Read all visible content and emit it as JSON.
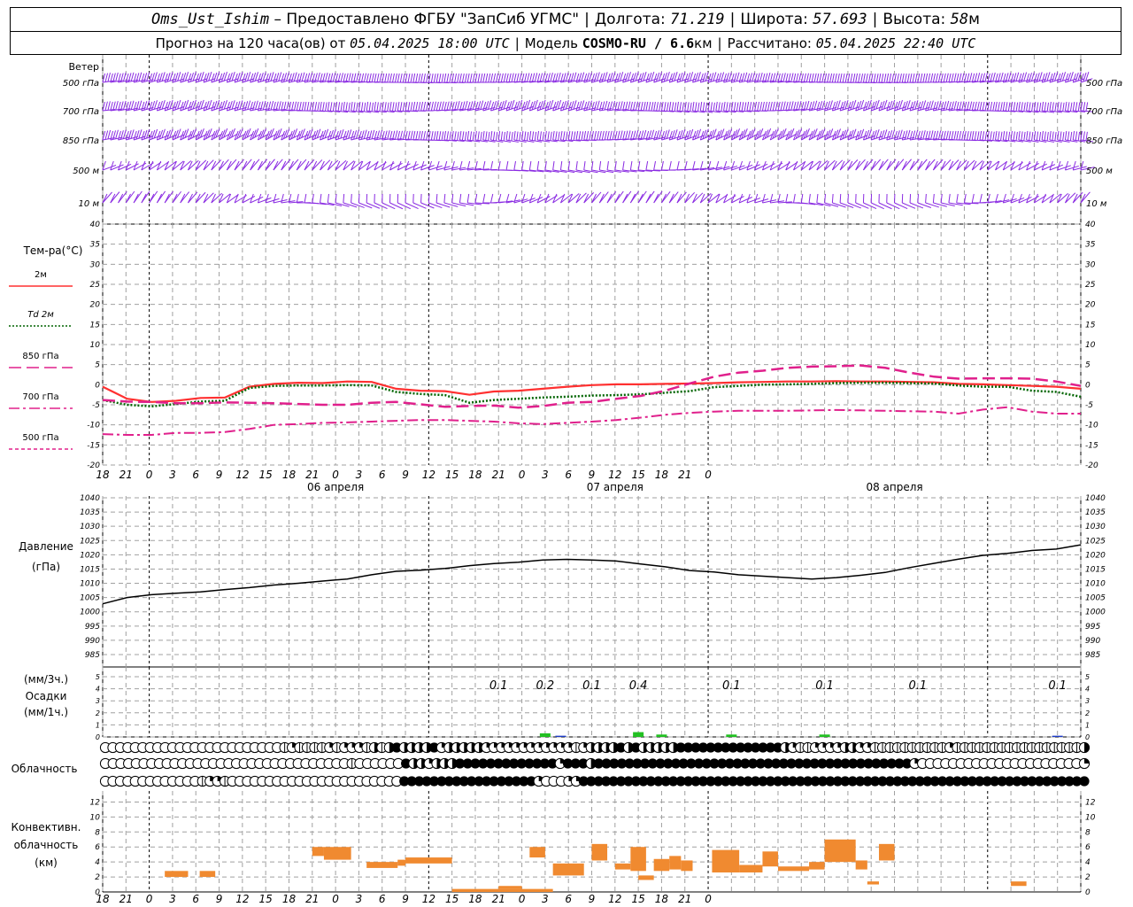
{
  "header": {
    "station": "Oms_Ust_Ishim",
    "provider": "– Предоставлено ФГБУ \"ЗапСиб УГМС\"",
    "lon_label": "Долгота:",
    "lon": "71.219",
    "lat_label": "Широта:",
    "lat": "57.693",
    "alt_label": "Высота:",
    "alt": "58",
    "alt_unit": "м",
    "forecast_label": "Прогноз на 120 часа(ов) от",
    "forecast_from": "05.04.2025 18:00 UTC",
    "model_label": "Модель",
    "model": "COSMO-RU / 6.6",
    "model_unit": "км",
    "calc_label": "Рассчитано:",
    "calc_time": "05.04.2025 22:40 UTC"
  },
  "colors": {
    "wind": "#8a2be2",
    "t2m": "#ff3030",
    "td2m": "#006400",
    "t850": "#e0208c",
    "precip_green": "#22c022",
    "precip_blue": "#1e3cc8",
    "convective": "#f08a30",
    "pressure": "#000000",
    "grid": "#a0a0a0"
  },
  "chart_data": [
    {
      "type": "barbs",
      "panel": "wind",
      "title": "Ветер",
      "levels": [
        "500 гПа",
        "700 гПа",
        "850 гПа",
        "500 м",
        "10 м"
      ]
    },
    {
      "type": "line",
      "panel": "temperature",
      "title": "Тем-ра(°С)",
      "ylim": [
        -20,
        40
      ],
      "yticks": [
        -20,
        -15,
        -10,
        -5,
        0,
        5,
        10,
        15,
        20,
        25,
        30,
        35,
        40
      ],
      "x_ticks": [
        "18",
        "21",
        "0",
        "3",
        "6",
        "9",
        "12",
        "15",
        "18",
        "21",
        "0",
        "3",
        "6",
        "9",
        "12",
        "15",
        "18",
        "21",
        "0",
        "3",
        "6",
        "9",
        "12",
        "15",
        "18",
        "21",
        "0"
      ],
      "day_labels": [
        "06 апреля",
        "07 апреля",
        "08 апреля"
      ],
      "series": [
        {
          "name": "2м",
          "style": "solid",
          "values": [
            -0.5,
            -3.5,
            -4.3,
            -4.0,
            -3.3,
            -3.2,
            -0.5,
            0.2,
            0.5,
            0.4,
            0.8,
            0.7,
            -1.0,
            -1.5,
            -1.6,
            -2.5,
            -1.7,
            -1.5,
            -1.0,
            -0.5,
            -0.1,
            0.1,
            0.1,
            0.2,
            0.3,
            0.4,
            0.6,
            0.7,
            0.8,
            0.8,
            0.9,
            0.8,
            0.8,
            0.7,
            0.6,
            0.2,
            0.1,
            -0.1,
            -0.3,
            -0.5,
            -1.0
          ]
        },
        {
          "name": "Td 2м",
          "style": "dotted",
          "values": [
            -3.8,
            -5.0,
            -5.4,
            -4.8,
            -4.2,
            -4.0,
            -0.8,
            -0.3,
            -0.2,
            -0.2,
            -0.1,
            -0.2,
            -1.8,
            -2.3,
            -2.6,
            -4.5,
            -3.8,
            -3.5,
            -3.2,
            -3.0,
            -2.7,
            -2.6,
            -2.4,
            -2.0,
            -1.6,
            -0.6,
            -0.3,
            0.0,
            0.1,
            0.2,
            0.4,
            0.5,
            0.5,
            0.4,
            0.3,
            -0.2,
            -0.5,
            -0.5,
            -1.5,
            -1.8,
            -3.0
          ]
        },
        {
          "name": "850 гПа",
          "style": "long-dash",
          "values": [
            -3.8,
            -4.2,
            -4.3,
            -4.6,
            -4.6,
            -4.4,
            -4.5,
            -4.6,
            -4.8,
            -5.0,
            -5.0,
            -4.5,
            -4.3,
            -4.9,
            -5.5,
            -5.3,
            -5.2,
            -5.7,
            -5.3,
            -4.5,
            -4.3,
            -3.5,
            -2.8,
            -1.5,
            0.3,
            2.0,
            3.0,
            3.5,
            4.2,
            4.5,
            4.6,
            4.8,
            4.2,
            3.0,
            2.0,
            1.5,
            1.6,
            1.6,
            1.5,
            0.8,
            -0.3
          ]
        },
        {
          "name": "700 гПа",
          "style": "dash-dot",
          "values": [
            -12.3,
            -12.5,
            -12.5,
            -12.0,
            -12.0,
            -11.8,
            -11.0,
            -10.0,
            -9.8,
            -9.5,
            -9.4,
            -9.2,
            -9.0,
            -8.8,
            -8.8,
            -9.0,
            -9.2,
            -9.6,
            -9.8,
            -9.5,
            -9.2,
            -8.8,
            -8.2,
            -7.5,
            -7.0,
            -6.7,
            -6.5,
            -6.5,
            -6.5,
            -6.4,
            -6.3,
            -6.4,
            -6.5,
            -6.6,
            -6.7,
            -7.2,
            -6.2,
            -5.6,
            -6.7,
            -7.2,
            -7.2
          ]
        },
        {
          "name": "500 гПа",
          "style": "short-dash",
          "values": []
        }
      ]
    },
    {
      "type": "line",
      "panel": "pressure",
      "title": "Давление",
      "ylabel": "(гПа)",
      "ylim": [
        985,
        1040
      ],
      "yticks": [
        985,
        990,
        995,
        1000,
        1005,
        1010,
        1015,
        1020,
        1025,
        1030,
        1035,
        1040
      ],
      "series": [
        {
          "name": "",
          "values": [
            1002.8,
            1005.0,
            1006.0,
            1006.5,
            1007.0,
            1007.8,
            1008.5,
            1009.4,
            1010.0,
            1010.8,
            1011.5,
            1013.0,
            1014.2,
            1014.6,
            1015.2,
            1016.2,
            1016.9,
            1017.4,
            1018.2,
            1018.4,
            1018.2,
            1017.8,
            1016.8,
            1015.8,
            1014.5,
            1014.0,
            1013.0,
            1012.5,
            1012.0,
            1011.5,
            1012.0,
            1012.8,
            1013.8,
            1015.5,
            1017.0,
            1018.5,
            1019.8,
            1020.5,
            1021.5,
            1022.0,
            1023.5
          ]
        }
      ]
    },
    {
      "type": "bar",
      "panel": "precipitation",
      "title": "Осадки",
      "ylabels": [
        "(мм/3ч.)",
        "(мм/1ч.)"
      ],
      "ylim": [
        0,
        5
      ],
      "yticks": [
        0,
        1,
        2,
        3,
        4,
        5
      ],
      "annotations": [
        {
          "hour": 51,
          "text": "0.1"
        },
        {
          "hour": 57,
          "text": "0.2"
        },
        {
          "hour": 63,
          "text": "0.1"
        },
        {
          "hour": 69,
          "text": "0.4"
        },
        {
          "hour": 81,
          "text": "0.1"
        },
        {
          "hour": 93,
          "text": "0.1"
        },
        {
          "hour": 105,
          "text": "0.1"
        },
        {
          "hour": 123,
          "text": "0.1"
        }
      ],
      "bars": [
        {
          "hour": 57,
          "value": 0.3,
          "kind": "green"
        },
        {
          "hour": 59,
          "value": 0.1,
          "kind": "blue"
        },
        {
          "hour": 69,
          "value": 0.4,
          "kind": "green"
        },
        {
          "hour": 72,
          "value": 0.2,
          "kind": "green"
        },
        {
          "hour": 81,
          "value": 0.2,
          "kind": "green"
        },
        {
          "hour": 93,
          "value": 0.2,
          "kind": "green"
        },
        {
          "hour": 123,
          "value": 0.1,
          "kind": "blue"
        }
      ]
    },
    {
      "type": "table",
      "panel": "cloudiness",
      "title": "Облачность",
      "rows": [
        [
          0,
          0,
          0,
          0,
          0,
          0,
          0,
          0,
          0,
          0,
          0,
          0,
          0,
          0,
          0,
          0,
          0,
          0,
          0,
          0,
          0,
          0,
          0,
          0,
          1,
          2,
          1,
          1,
          1,
          1,
          2,
          1,
          2,
          2,
          2,
          1,
          3,
          1,
          3,
          4,
          3,
          3,
          3,
          3,
          4,
          2,
          3,
          3,
          3,
          3,
          3,
          2,
          2,
          2,
          2,
          2,
          2,
          2,
          2,
          2,
          2,
          2,
          2,
          1,
          2,
          3,
          3,
          3,
          3,
          4,
          3,
          4,
          3,
          3,
          3,
          3,
          3,
          4,
          4,
          4,
          4,
          4,
          4,
          4,
          4,
          4,
          4,
          4,
          4,
          4,
          4,
          3,
          2,
          1,
          1,
          2,
          2,
          2,
          2,
          3,
          3,
          2,
          2,
          1,
          1,
          1,
          1,
          1,
          1,
          1,
          1,
          1,
          1,
          2,
          1,
          1,
          1,
          1,
          1,
          1,
          1,
          1,
          1,
          1,
          1,
          1,
          1,
          1,
          1,
          1,
          1,
          3
        ],
        [
          0,
          0,
          0,
          0,
          0,
          0,
          0,
          0,
          0,
          0,
          0,
          0,
          0,
          0,
          0,
          0,
          0,
          0,
          0,
          0,
          0,
          0,
          0,
          0,
          0,
          0,
          0,
          0,
          0,
          0,
          0,
          0,
          1,
          0,
          0,
          0,
          0,
          0,
          0,
          4,
          3,
          3,
          2,
          3,
          3,
          3,
          4,
          4,
          4,
          4,
          4,
          4,
          4,
          4,
          4,
          4,
          4,
          4,
          4,
          2,
          4,
          4,
          4,
          3,
          4,
          4,
          4,
          4,
          4,
          4,
          4,
          4,
          4,
          4,
          4,
          4,
          4,
          4,
          4,
          4,
          4,
          4,
          4,
          4,
          4,
          4,
          4,
          4,
          4,
          4,
          4,
          4,
          4,
          4,
          4,
          4,
          4,
          4,
          4,
          4,
          4,
          4,
          4,
          4,
          4,
          2,
          0,
          0,
          0,
          0,
          0,
          0,
          0,
          0,
          0,
          0,
          0,
          0,
          0,
          0,
          0,
          0,
          0,
          0,
          0,
          0,
          0,
          2
        ],
        [
          0,
          0,
          0,
          0,
          0,
          0,
          0,
          0,
          0,
          0,
          0,
          0,
          0,
          1,
          2,
          2,
          1,
          0,
          0,
          0,
          0,
          0,
          0,
          0,
          0,
          0,
          0,
          0,
          0,
          0,
          0,
          0,
          0,
          0,
          0,
          0,
          0,
          0,
          0,
          0,
          4,
          4,
          4,
          4,
          4,
          4,
          4,
          4,
          4,
          4,
          4,
          4,
          4,
          4,
          4,
          4,
          4,
          4,
          2,
          0,
          0,
          0,
          2,
          2,
          4,
          4,
          4,
          4,
          4,
          4,
          4,
          4,
          4,
          4,
          4,
          4,
          4,
          4,
          4,
          4,
          4,
          4,
          4,
          4,
          4,
          4,
          4,
          4,
          4,
          4,
          4,
          4,
          4,
          4,
          4,
          4,
          4,
          4,
          4,
          4,
          4,
          4,
          4,
          4,
          4,
          4,
          4,
          4,
          4,
          4,
          4,
          4,
          4,
          4,
          4,
          4,
          4,
          4,
          4,
          4,
          4,
          4,
          4,
          4,
          4,
          4,
          4,
          4,
          4,
          4,
          4,
          4
        ]
      ]
    },
    {
      "type": "bar",
      "panel": "convective",
      "title": "Конвективн. облачность",
      "ylabel": "(км)",
      "ylim": [
        0,
        13
      ],
      "yticks": [
        0,
        2,
        4,
        6,
        8,
        10,
        12
      ],
      "ranges": [
        {
          "h0": 8,
          "h1": 11,
          "base": 2.0,
          "top": 2.8
        },
        {
          "h0": 12.5,
          "h1": 14.5,
          "base": 2.0,
          "top": 2.8
        },
        {
          "h0": 27,
          "h1": 28.5,
          "base": 4.8,
          "top": 6.0
        },
        {
          "h0": 28.5,
          "h1": 32,
          "base": 4.3,
          "top": 6.0
        },
        {
          "h0": 34,
          "h1": 38,
          "base": 3.2,
          "top": 4.0
        },
        {
          "h0": 38,
          "h1": 39,
          "base": 3.5,
          "top": 4.3
        },
        {
          "h0": 39,
          "h1": 45,
          "base": 3.8,
          "top": 4.6
        },
        {
          "h0": 45,
          "h1": 58,
          "base": 0.0,
          "top": 0.4
        },
        {
          "h0": 51,
          "h1": 54,
          "base": 0.4,
          "top": 0.8
        },
        {
          "h0": 55,
          "h1": 57,
          "base": 4.6,
          "top": 6.0
        },
        {
          "h0": 58,
          "h1": 62,
          "base": 2.2,
          "top": 3.8
        },
        {
          "h0": 63,
          "h1": 65,
          "base": 4.2,
          "top": 6.4
        },
        {
          "h0": 66,
          "h1": 68,
          "base": 3.0,
          "top": 3.8
        },
        {
          "h0": 68,
          "h1": 70,
          "base": 2.8,
          "top": 6.0
        },
        {
          "h0": 69,
          "h1": 71,
          "base": 1.6,
          "top": 2.2
        },
        {
          "h0": 71,
          "h1": 73,
          "base": 2.8,
          "top": 4.4
        },
        {
          "h0": 73,
          "h1": 74.5,
          "base": 3.0,
          "top": 4.8
        },
        {
          "h0": 74.5,
          "h1": 76,
          "base": 2.8,
          "top": 4.2
        },
        {
          "h0": 78.5,
          "h1": 82,
          "base": 2.6,
          "top": 5.6
        },
        {
          "h0": 82,
          "h1": 85,
          "base": 2.6,
          "top": 3.6
        },
        {
          "h0": 85,
          "h1": 87,
          "base": 3.4,
          "top": 5.4
        },
        {
          "h0": 87,
          "h1": 91,
          "base": 2.8,
          "top": 3.4
        },
        {
          "h0": 91,
          "h1": 93,
          "base": 3.0,
          "top": 4.0
        },
        {
          "h0": 93,
          "h1": 97,
          "base": 4.0,
          "top": 7.0
        },
        {
          "h0": 97,
          "h1": 98.5,
          "base": 3.0,
          "top": 4.2
        },
        {
          "h0": 98.5,
          "h1": 100,
          "base": 1.0,
          "top": 1.4
        },
        {
          "h0": 100,
          "h1": 102,
          "base": 4.2,
          "top": 6.4
        },
        {
          "h0": 117,
          "h1": 119,
          "base": 0.8,
          "top": 1.4
        }
      ]
    }
  ]
}
